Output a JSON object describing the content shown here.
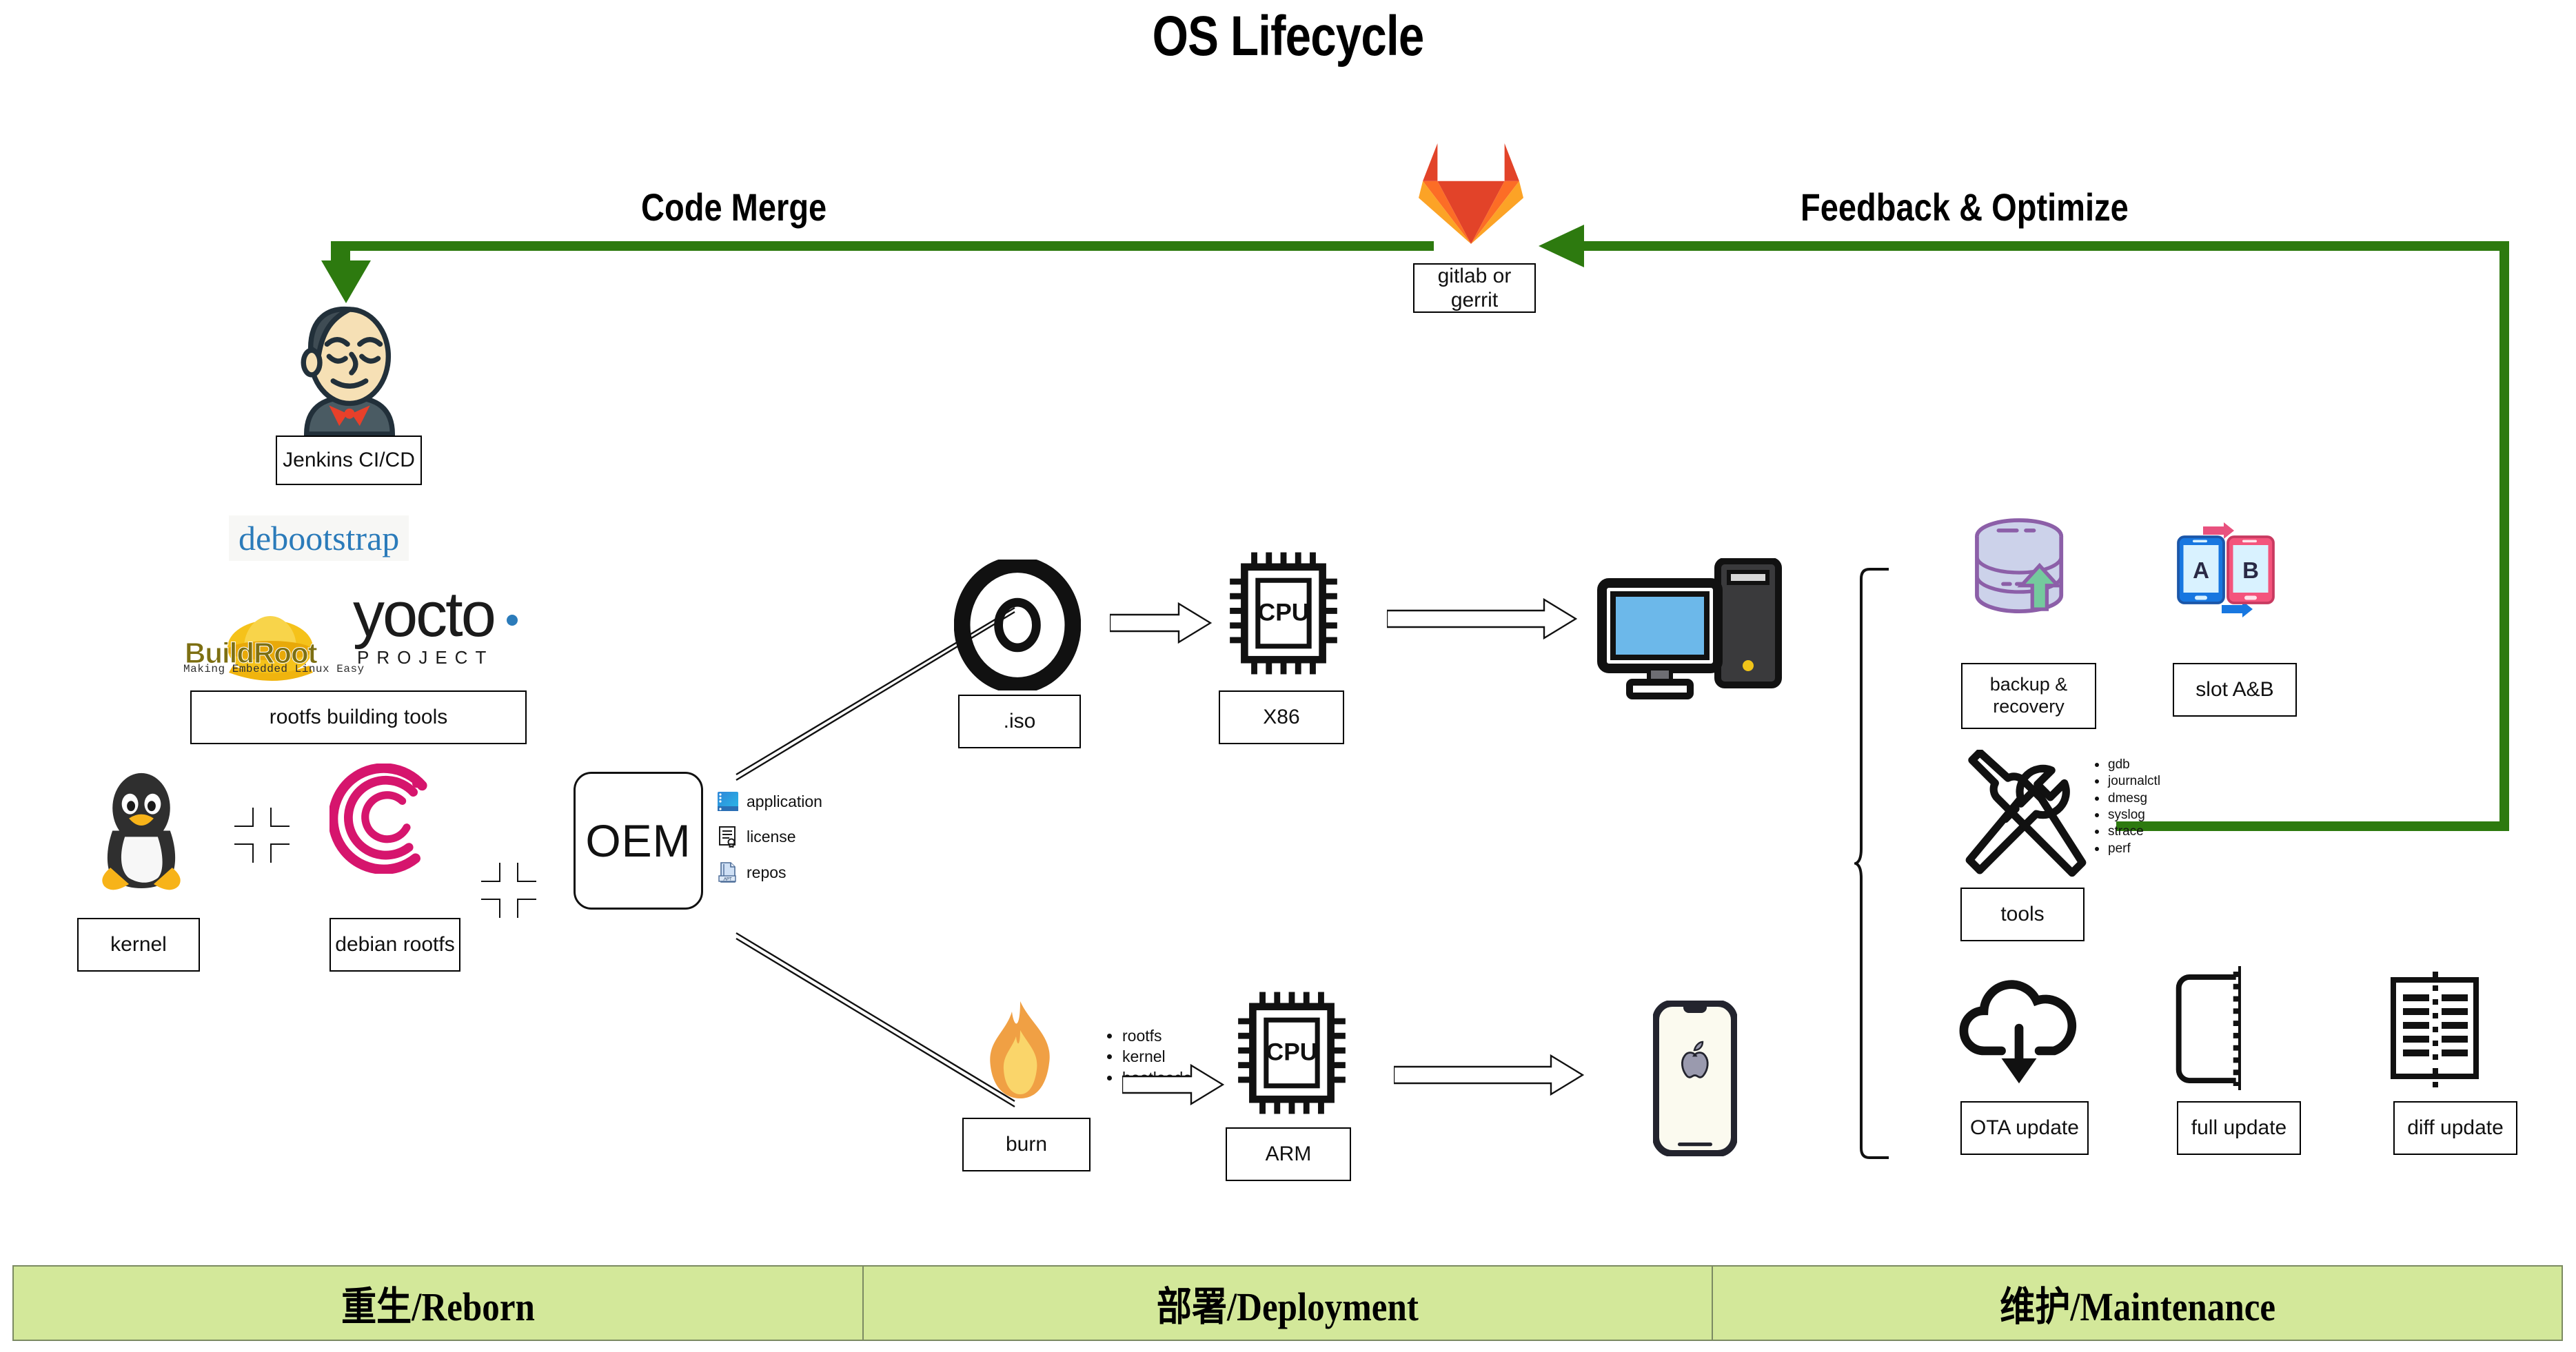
{
  "title": "OS Lifecycle",
  "flow": {
    "code_merge": "Code Merge",
    "feedback": "Feedback & Optimize"
  },
  "reborn": {
    "gitlab_caption": "gitlab or gerrit",
    "jenkins_caption": "Jenkins CI/CD",
    "debootstrap": "debootstrap",
    "yocto_word": "yocto",
    "yocto_sub": "PROJECT",
    "buildroot_name": "BuildRoot",
    "buildroot_tagline": "Making Embedded Linux Easy",
    "rootfs_tools_caption": "rootfs building tools",
    "kernel_caption": "kernel",
    "debian_caption": "debian rootfs",
    "oem_label": "OEM",
    "oem_items": [
      {
        "icon": "application-window-icon",
        "label": "application"
      },
      {
        "icon": "license-certificate-icon",
        "label": "license"
      },
      {
        "icon": "apt-repo-file-icon",
        "label": "repos"
      }
    ]
  },
  "deployment": {
    "iso_caption": ".iso",
    "x86_caption": "X86",
    "cpu_label": "CPU",
    "burn_caption": "burn",
    "arm_caption": "ARM",
    "burn_items": [
      "rootfs",
      "kernel",
      "bootloader"
    ]
  },
  "maintenance": {
    "backup_caption": "backup & recovery",
    "slot_caption": "slot A&B",
    "slot_a": "A",
    "slot_b": "B",
    "tools_caption": "tools",
    "tools_items": [
      "gdb",
      "journalctl",
      "dmesg",
      "syslog",
      "strace",
      "perf"
    ],
    "ota_caption": "OTA update",
    "full_caption": "full update",
    "diff_caption": "diff update"
  },
  "banner": [
    "重生/Reborn",
    "部署/Deployment",
    "维护/Maintenance"
  ],
  "colors": {
    "flow_green": "#2d7a0f",
    "banner_green": "#d3e89a",
    "banner_border": "#7b8a62",
    "debootstrap_blue": "#2b7bba",
    "debian_magenta": "#d6156d",
    "gitlab_red": "#e24329",
    "gitlab_orange": "#fc6d26",
    "gitlab_amber": "#fca326",
    "slot_a_blue": "#1877e0",
    "slot_b_pink": "#f4547c",
    "monitor_blue": "#6cb8ea"
  }
}
